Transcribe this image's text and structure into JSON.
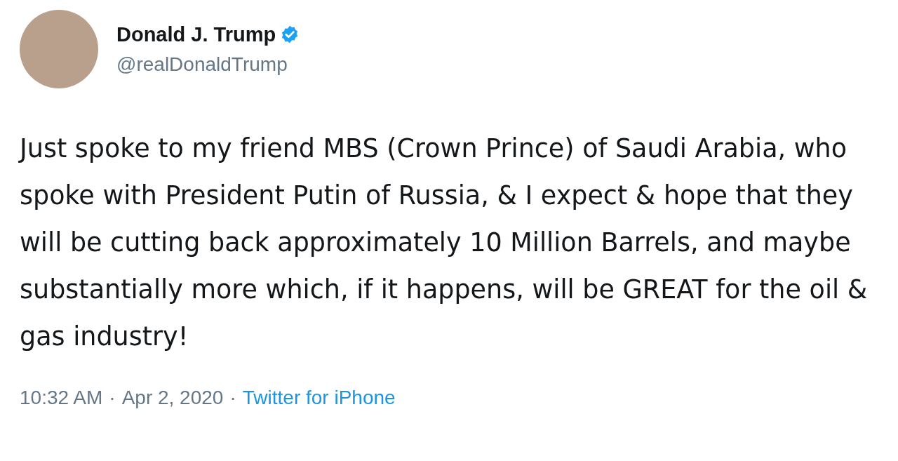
{
  "author": {
    "name": "Donald J. Trump",
    "verified": true,
    "handle": "@realDonaldTrump"
  },
  "tweet": {
    "text": "Just spoke to my friend MBS (Crown Prince) of Saudi Arabia, who spoke with President Putin of Russia, & I expect & hope that they will be cutting back approximately 10 Million Barrels, and maybe substantially more which, if it happens, will be GREAT for the oil & gas industry!"
  },
  "meta": {
    "time": "10:32 AM",
    "separators": [
      "·",
      "·"
    ],
    "date": "Apr 2, 2020",
    "source": "Twitter for iPhone"
  }
}
